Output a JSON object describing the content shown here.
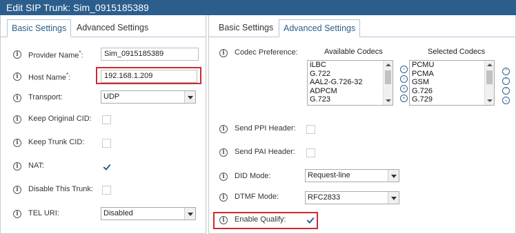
{
  "title": "Edit SIP Trunk: Sim_0915185389",
  "left": {
    "tabs": [
      "Basic Settings",
      "Advanced Settings"
    ],
    "fields": {
      "provider_name": {
        "label": "Provider Name",
        "req": "*",
        "colon": ":",
        "value": "Sim_0915185389"
      },
      "host_name": {
        "label": "Host Name",
        "req": "*",
        "colon": ":",
        "value": "192.168.1.209"
      },
      "transport": {
        "label": "Transport:",
        "value": "UDP"
      },
      "keep_original_cid": {
        "label": "Keep Original CID:",
        "checked": false
      },
      "keep_trunk_cid": {
        "label": "Keep Trunk CID:",
        "checked": false
      },
      "nat": {
        "label": "NAT:",
        "checked": true
      },
      "disable_trunk": {
        "label": "Disable This Trunk:",
        "checked": false
      },
      "tel_uri": {
        "label": "TEL URI:",
        "value": "Disabled"
      }
    }
  },
  "right": {
    "tabs": [
      "Basic Settings",
      "Advanced Settings"
    ],
    "codec": {
      "label": "Codec Preference:",
      "available_title": "Available Codecs",
      "selected_title": "Selected Codecs",
      "available": [
        "iLBC",
        "G.722",
        "AAL2-G.726-32",
        "ADPCM",
        "G.723"
      ],
      "selected": [
        "PCMU",
        "PCMA",
        "GSM",
        "G.726",
        "G.729"
      ]
    },
    "send_ppi": {
      "label": "Send PPI Header:",
      "checked": false
    },
    "send_pai": {
      "label": "Send PAI Header:",
      "checked": false
    },
    "did_mode": {
      "label": "DID Mode:",
      "value": "Request-line"
    },
    "dtmf_mode": {
      "label": "DTMF Mode:",
      "value": "RFC2833"
    },
    "enable_qualify": {
      "label": "Enable Qualify:",
      "checked": true
    }
  },
  "icons": {
    "info": "i",
    "move_right": "›",
    "move_left": "‹",
    "move_all_right": "»",
    "move_all_left": "«",
    "move_top": "⌃",
    "move_up": "˄",
    "move_down": "˅",
    "move_bottom": "⌄"
  },
  "colors": {
    "titlebar": "#2b5e8c",
    "highlight": "#d0282e",
    "tab_active": "#2b5e8c"
  }
}
